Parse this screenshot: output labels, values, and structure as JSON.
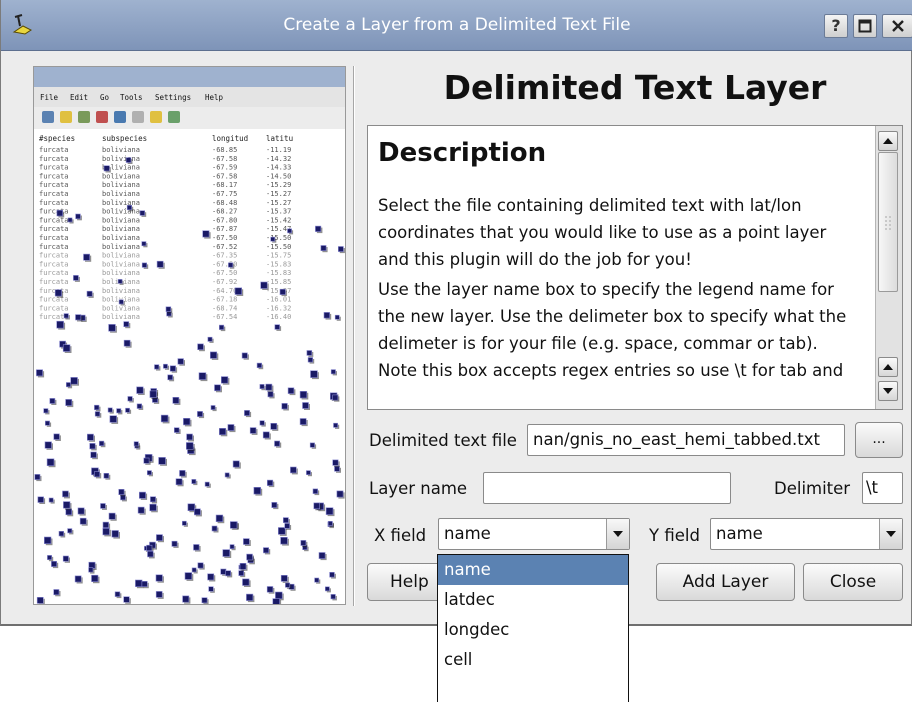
{
  "window": {
    "title": "Create a Layer from a Delimited Text File",
    "controls": [
      "?",
      "maximize",
      "close"
    ],
    "titlebar_color": "#8ea2c4"
  },
  "preview": {
    "menu": [
      "File",
      "Edit",
      "Go",
      "Tools",
      "Settings",
      "Help"
    ],
    "columns": [
      "#species",
      "subspecies",
      "longitud",
      "latitu"
    ],
    "rows": [
      [
        "furcata",
        "boliviana",
        "-68.85",
        "-11.19"
      ],
      [
        "furcata",
        "boliviana",
        "-67.58",
        "-14.32"
      ],
      [
        "furcata",
        "boliviana",
        "-67.59",
        "-14.33"
      ],
      [
        "furcata",
        "boliviana",
        "-67.58",
        "-14.50"
      ],
      [
        "furcata",
        "boliviana",
        "-68.17",
        "-15.29"
      ],
      [
        "furcata",
        "boliviana",
        "-67.75",
        "-15.27"
      ],
      [
        "furcata",
        "boliviana",
        "-68.48",
        "-15.27"
      ],
      [
        "furcata",
        "boliviana",
        "-68.27",
        "-15.37"
      ],
      [
        "furcata",
        "boliviana",
        "-67.80",
        "-15.42"
      ],
      [
        "furcata",
        "boliviana",
        "-67.87",
        "-15.47"
      ],
      [
        "furcata",
        "boliviana",
        "-67.50",
        "-15.50"
      ],
      [
        "furcata",
        "boliviana",
        "-67.52",
        "-15.50"
      ],
      [
        "furcata",
        "boliviana",
        "-67.35",
        "-15.75"
      ],
      [
        "furcata",
        "boliviana",
        "-67.50",
        "-15.83"
      ],
      [
        "furcata",
        "boliviana",
        "-67.50",
        "-15.83"
      ],
      [
        "furcata",
        "boliviana",
        "-67.92",
        "-15.85"
      ],
      [
        "furcata",
        "boliviana",
        "-64.70",
        "-15.97"
      ],
      [
        "furcata",
        "boliviana",
        "-67.18",
        "-16.01"
      ],
      [
        "furcata",
        "boliviana",
        "-68.74",
        "-16.32"
      ],
      [
        "furcata",
        "boliviana",
        "-67.54",
        "-16.40"
      ]
    ],
    "point_color": "#1a1a66"
  },
  "heading": "Delimited Text Layer",
  "description": {
    "title": "Description",
    "paragraphs": [
      "Select the file containing delimited text with lat/lon coordinates that you would like to use as a point layer and this plugin will do the job for you!",
      "Use the layer name box to specify the legend name for the new layer. Use the delimeter box to specify what the delimeter is for your file (e.g. space, commar or tab). Note this box accepts regex entries so use \\t for tab and"
    ]
  },
  "form": {
    "file_label": "Delimited text file",
    "file_value": "nan/gnis_no_east_hemi_tabbed.txt",
    "browse_label": "...",
    "layer_name_label": "Layer name",
    "layer_name_value": "",
    "delimiter_label": "Delimiter",
    "delimiter_value": "\\t",
    "x_field_label": "X field",
    "x_field_value": "name",
    "y_field_label": "Y field",
    "y_field_value": "name"
  },
  "buttons": {
    "help": "Help",
    "add_layer": "Add Layer",
    "close": "Close"
  },
  "dropdown": {
    "items": [
      "name",
      "latdec",
      "longdec",
      "cell"
    ],
    "selected": "name",
    "highlight_color": "#5b82b2"
  }
}
